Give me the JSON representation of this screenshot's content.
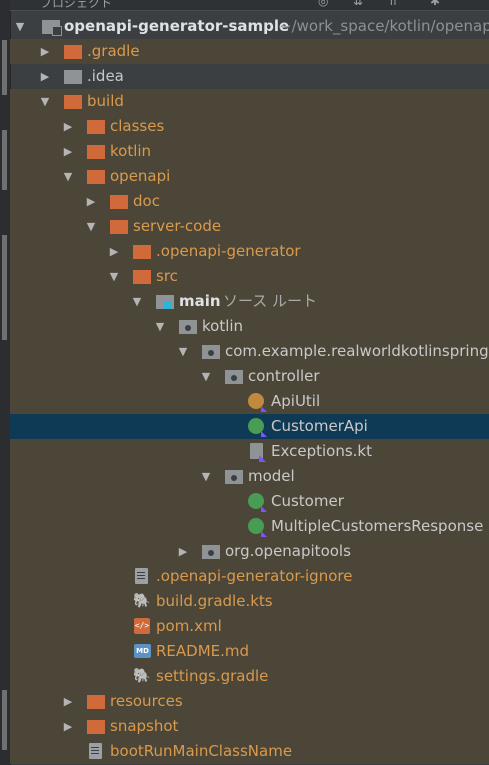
{
  "topbar": {
    "title": "プロジェクト",
    "icons": [
      "target-icon",
      "collapse-icon",
      "expand-icon",
      "gear-icon"
    ]
  },
  "tree": {
    "root": {
      "name": "openapi-generator-sample",
      "path": "~/work_space/kotlin/openapi"
    },
    "nodes": [
      {
        "label": ".gradle"
      },
      {
        "label": ".idea"
      },
      {
        "label": "build"
      },
      {
        "label": "classes"
      },
      {
        "label": "kotlin"
      },
      {
        "label": "openapi"
      },
      {
        "label": "doc"
      },
      {
        "label": "server-code"
      },
      {
        "label": ".openapi-generator"
      },
      {
        "label": "src"
      },
      {
        "label": "main",
        "hint": "ソース ルート"
      },
      {
        "label": "kotlin"
      },
      {
        "label": "com.example.realworldkotlinspringb"
      },
      {
        "label": "controller"
      },
      {
        "label": "ApiUtil"
      },
      {
        "label": "CustomerApi"
      },
      {
        "label": "Exceptions.kt"
      },
      {
        "label": "model"
      },
      {
        "label": "Customer"
      },
      {
        "label": "MultipleCustomersResponse"
      },
      {
        "label": "org.openapitools"
      },
      {
        "label": ".openapi-generator-ignore"
      },
      {
        "label": "build.gradle.kts"
      },
      {
        "label": "pom.xml"
      },
      {
        "label": "README.md"
      },
      {
        "label": "settings.gradle"
      },
      {
        "label": "resources"
      },
      {
        "label": "snapshot"
      },
      {
        "label": "bootRunMainClassName"
      }
    ]
  },
  "colors": {
    "background": "#3b3f42",
    "excluded_row": "#4b4638",
    "selected_row": "#0f3a55",
    "folder_orange": "#d06a3a",
    "kotlin_class": "#499c54"
  }
}
